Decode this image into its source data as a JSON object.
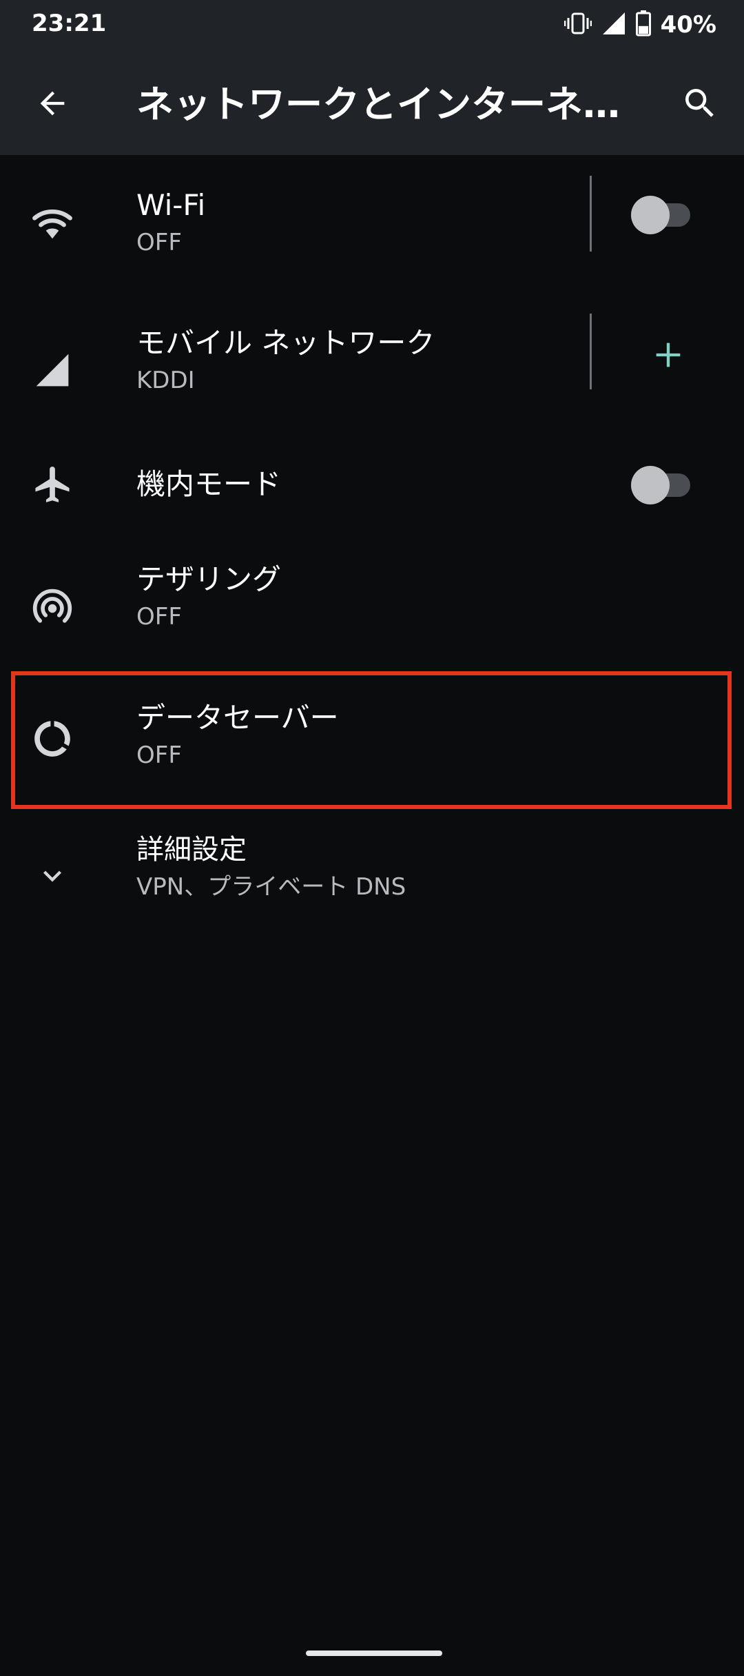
{
  "status_bar": {
    "time": "23:21",
    "battery_percent": "40%",
    "battery_level": 0.4,
    "icons": [
      "vibrate-icon",
      "signal-icon",
      "battery-icon"
    ]
  },
  "toolbar": {
    "title": "ネットワークとインターネ…",
    "back_icon": "arrow-back-icon",
    "search_icon": "search-icon"
  },
  "items": [
    {
      "key": "wifi",
      "icon": "wifi-icon",
      "title": "Wi-Fi",
      "summary": "OFF",
      "toggle": "off"
    },
    {
      "key": "mobile",
      "icon": "mobile-signal-icon",
      "title": "モバイル ネットワーク",
      "summary": "KDDI",
      "action": "add"
    },
    {
      "key": "airplane",
      "icon": "airplane-icon",
      "title": "機内モード",
      "toggle": "off"
    },
    {
      "key": "tethering",
      "icon": "hotspot-icon",
      "title": "テザリング",
      "summary": "OFF"
    },
    {
      "key": "data_saver",
      "icon": "data-saver-icon",
      "title": "データセーバー",
      "summary": "OFF",
      "highlighted": true
    },
    {
      "key": "advanced",
      "icon": "chevron-down-icon",
      "title": "詳細設定",
      "summary": "VPN、プライベート DNS"
    }
  ],
  "colors": {
    "toolbar_bg": "#202327",
    "page_bg": "#0b0c0e",
    "accent": "#7fd1c5",
    "highlight": "#e2361f"
  }
}
